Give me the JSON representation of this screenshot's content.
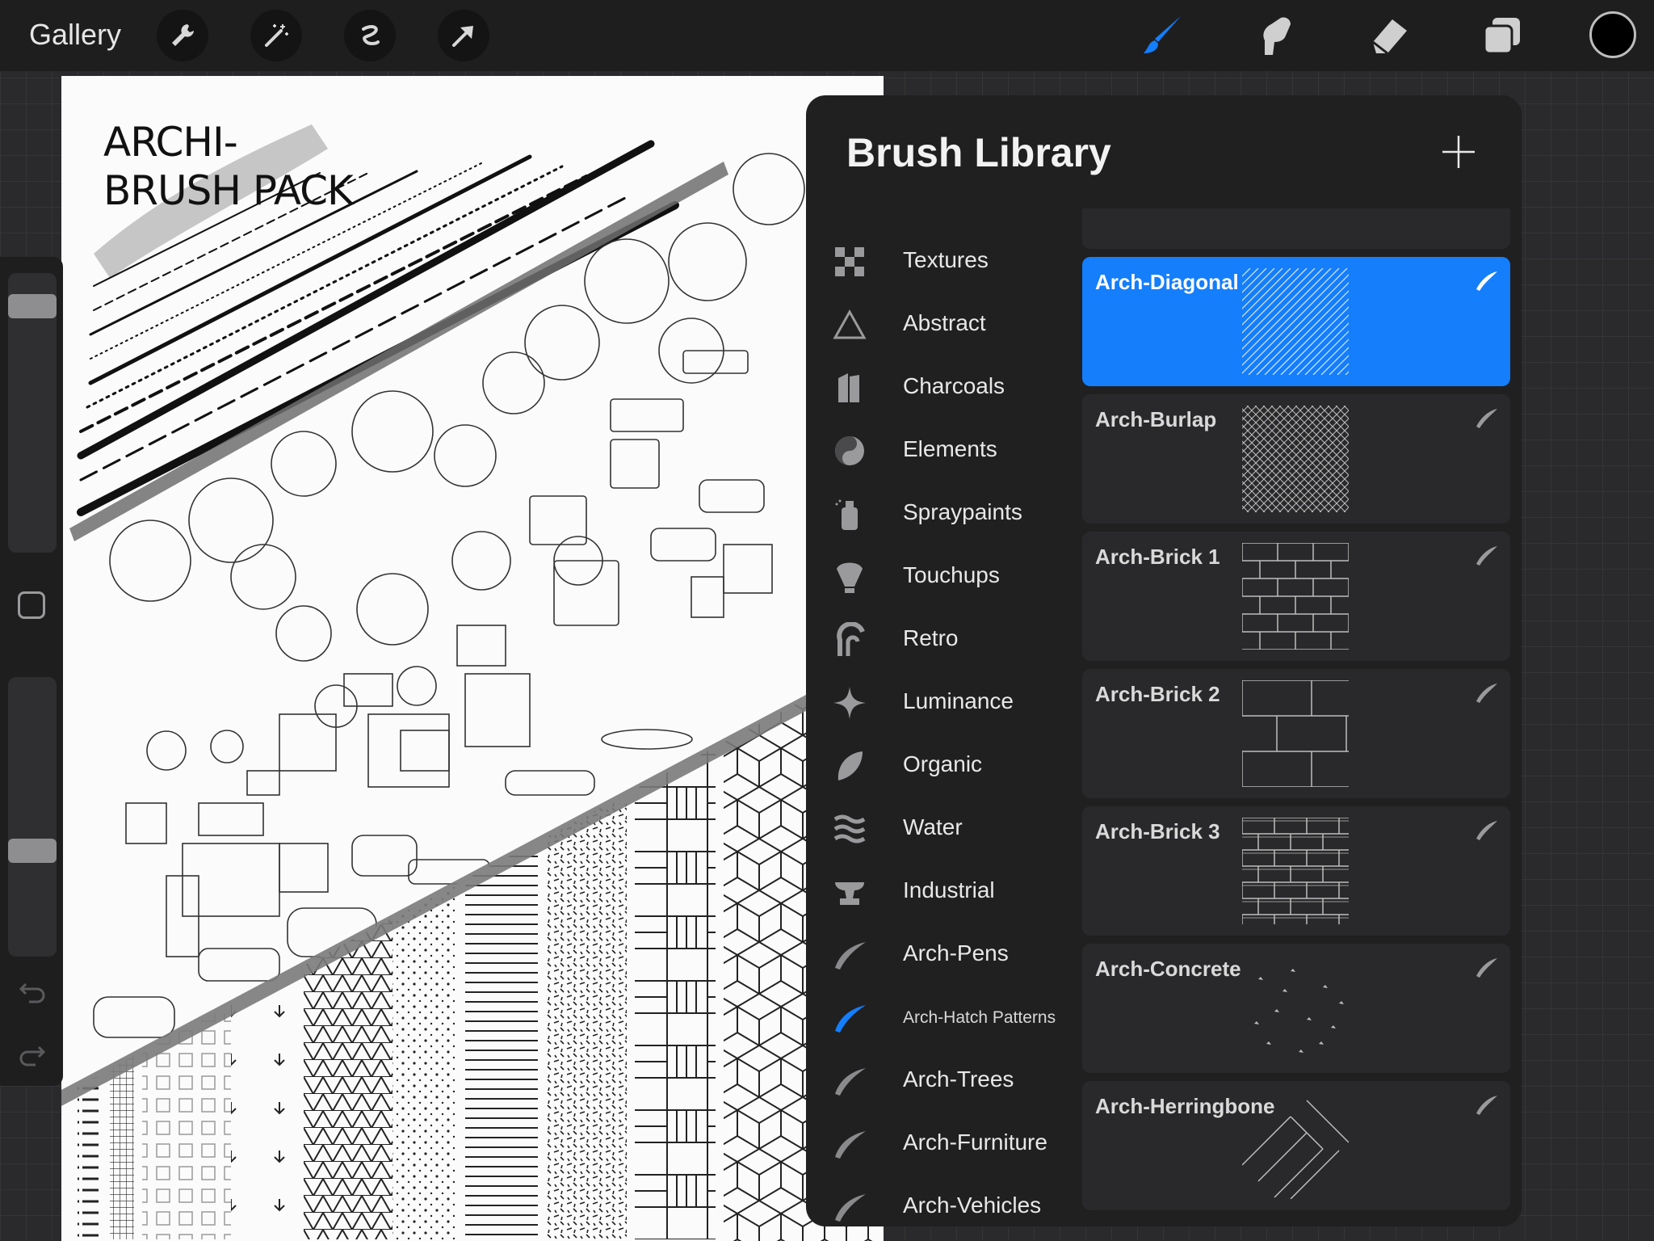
{
  "topbar": {
    "gallery_label": "Gallery",
    "tools_left": [
      "wrench-icon",
      "magic-wand-icon",
      "selection-icon",
      "transform-arrow-icon"
    ],
    "tools_right": [
      "brush-icon",
      "smudge-icon",
      "eraser-icon",
      "layers-icon"
    ],
    "active_tool": "brush",
    "active_color": "#000000",
    "accent": "#147efb"
  },
  "canvas": {
    "title_line1": "ARCHI-",
    "title_line2": "BRUSH PACK"
  },
  "sidebar": {
    "size_slider_value": 0.05,
    "opacity_slider_value": 0.6
  },
  "library": {
    "title": "Brush Library",
    "categories": [
      {
        "label": "Textures",
        "icon": "checker-icon"
      },
      {
        "label": "Abstract",
        "icon": "triangle-icon"
      },
      {
        "label": "Charcoals",
        "icon": "charcoal-icon"
      },
      {
        "label": "Elements",
        "icon": "yin-yang-icon"
      },
      {
        "label": "Spraypaints",
        "icon": "spray-can-icon"
      },
      {
        "label": "Touchups",
        "icon": "shell-icon"
      },
      {
        "label": "Retro",
        "icon": "retro-arc-icon"
      },
      {
        "label": "Luminance",
        "icon": "sparkle-icon"
      },
      {
        "label": "Organic",
        "icon": "leaf-icon"
      },
      {
        "label": "Water",
        "icon": "waves-icon"
      },
      {
        "label": "Industrial",
        "icon": "anvil-icon"
      },
      {
        "label": "Arch-Pens",
        "icon": "brush-stroke-icon"
      },
      {
        "label": "Arch-Hatch Patterns",
        "icon": "brush-stroke-icon",
        "selected": true
      },
      {
        "label": "Arch-Trees",
        "icon": "brush-stroke-icon"
      },
      {
        "label": "Arch-Furniture",
        "icon": "brush-stroke-icon"
      },
      {
        "label": "Arch-Vehicles",
        "icon": "brush-stroke-icon"
      }
    ],
    "brushes": [
      {
        "name": "",
        "preview": "grid-partial"
      },
      {
        "name": "Arch-Diagonal",
        "preview": "diagonal",
        "selected": true
      },
      {
        "name": "Arch-Burlap",
        "preview": "burlap"
      },
      {
        "name": "Arch-Brick 1",
        "preview": "brick1"
      },
      {
        "name": "Arch-Brick 2",
        "preview": "brick2"
      },
      {
        "name": "Arch-Brick 3",
        "preview": "brick3"
      },
      {
        "name": "Arch-Concrete",
        "preview": "concrete"
      },
      {
        "name": "Arch-Herringbone",
        "preview": "herringbone"
      }
    ]
  }
}
